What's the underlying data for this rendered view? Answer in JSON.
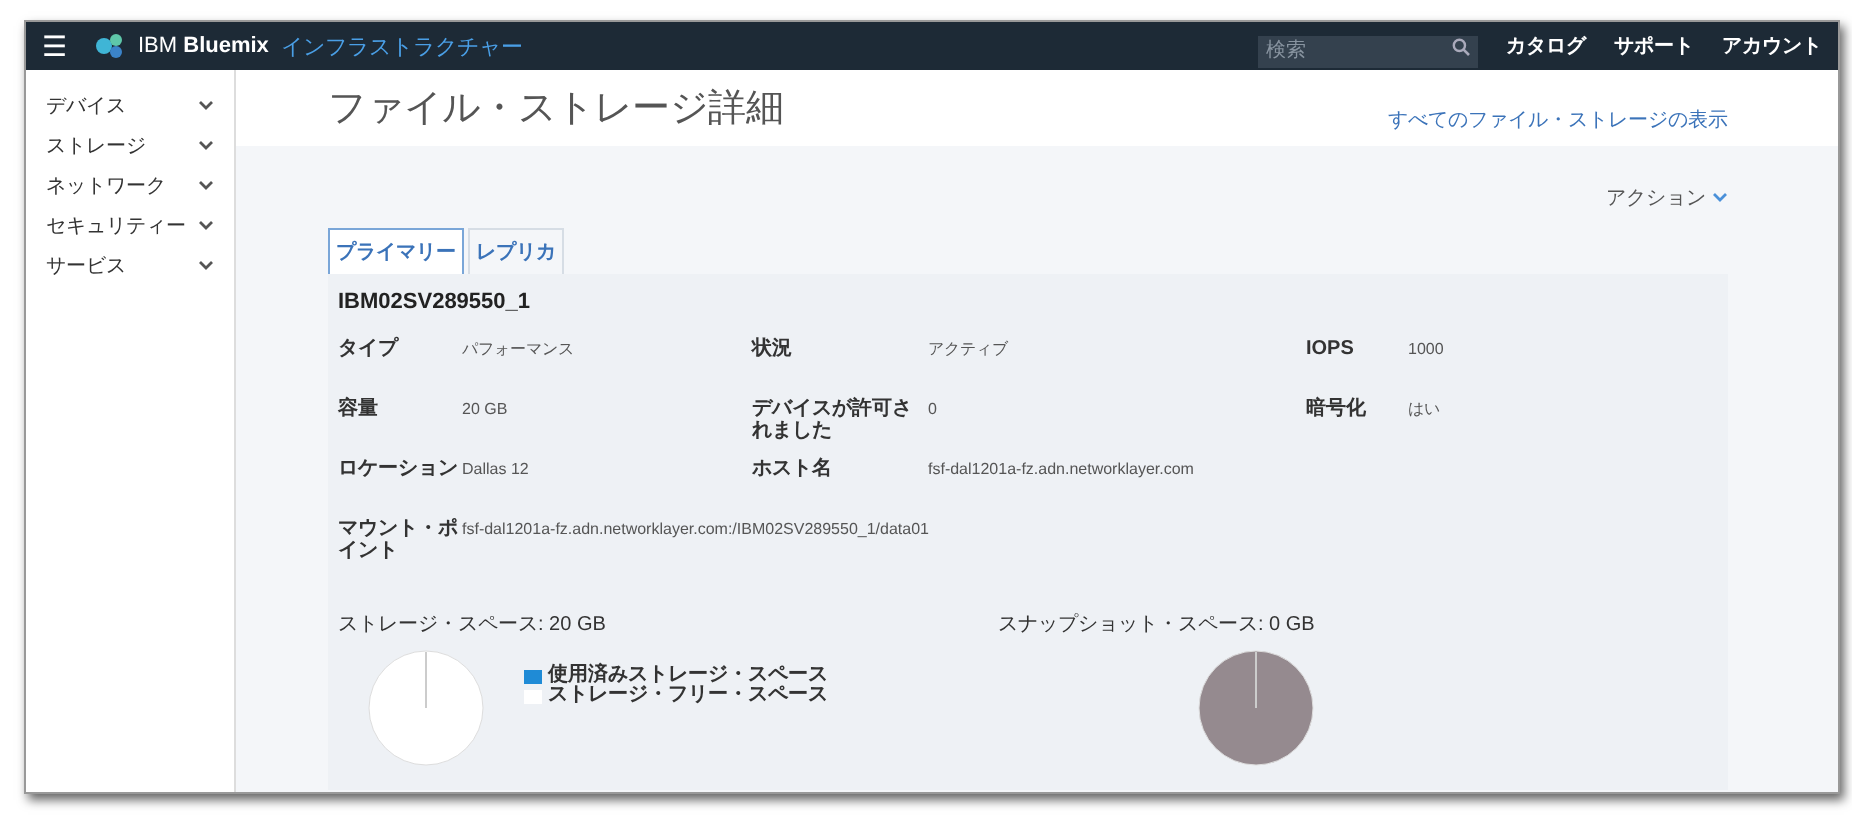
{
  "topbar": {
    "menu_icon": "☰",
    "brand": "IBM",
    "product": "Bluemix",
    "subtitle": "インフラストラクチャー",
    "search": {
      "placeholder": "検索"
    },
    "links": [
      "カタログ",
      "サポート",
      "アカウント"
    ]
  },
  "sidebar": {
    "items": [
      {
        "label": "デバイス",
        "expanded": false
      },
      {
        "label": "ストレージ",
        "expanded": false
      },
      {
        "label": "ネットワーク",
        "expanded": false
      },
      {
        "label": "セキュリティー",
        "expanded": false
      },
      {
        "label": "サービス",
        "expanded": false
      }
    ]
  },
  "page": {
    "title": "ファイル・ストレージ詳細",
    "link": "すべてのファイル・ストレージの表示",
    "actions": "アクション"
  },
  "tabs": [
    {
      "label": "プライマリー",
      "selected": true
    },
    {
      "label": "レプリカ",
      "selected": false
    }
  ],
  "volume": {
    "name": "IBM02SV289550_1",
    "rows": [
      [
        {
          "label": "タイプ",
          "value": "パフォーマンス"
        },
        {
          "label": "状況",
          "value": "アクティブ"
        },
        {
          "label": "IOPS",
          "value": "1000"
        }
      ],
      [
        {
          "label": "容量",
          "value": "20 GB"
        },
        {
          "label": "デバイスが許可されました",
          "value": "0"
        },
        {
          "label": "暗号化",
          "value": "はい"
        }
      ],
      [
        {
          "label": "ロケーション",
          "value": "Dallas 12"
        },
        {
          "label": "ホスト名",
          "value": "fsf-dal1201a-fz.adn.networklayer.com"
        }
      ],
      [
        {
          "label": "マウント・ポイント",
          "value": "fsf-dal1201a-fz.adn.networklayer.com:/IBM02SV289550_1/data01"
        }
      ]
    ]
  },
  "storage": {
    "title": "ストレージ・スペース: 20 GB",
    "legend": [
      {
        "label": "使用済みストレージ・スペース",
        "color": "#1f8bd6"
      },
      {
        "label": "ストレージ・フリー・スペース",
        "color": "#ffffff"
      }
    ]
  },
  "snapshot": {
    "title": "スナップショット・スペース: 0 GB"
  }
}
